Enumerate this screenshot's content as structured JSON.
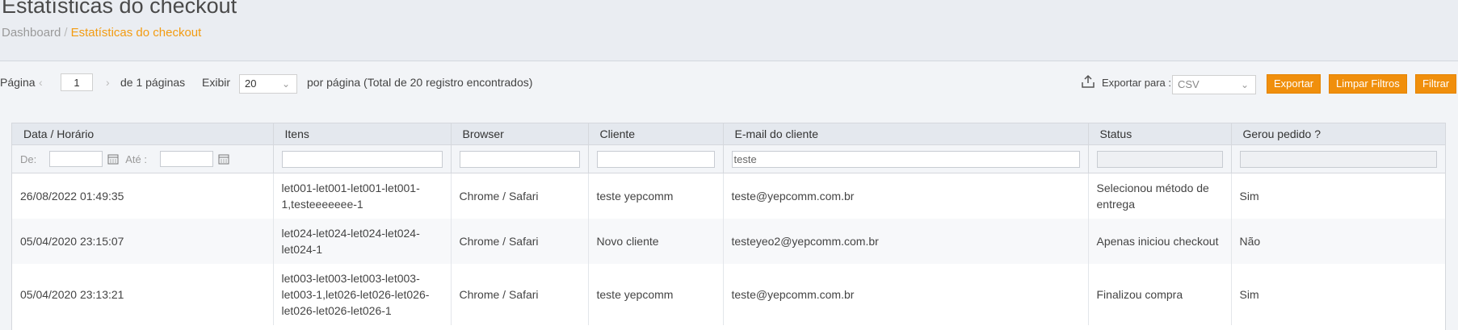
{
  "page": {
    "title": "Estatísticas do checkout",
    "breadcrumb": {
      "home": "Dashboard",
      "separator": "/",
      "current": "Estatísticas do checkout"
    }
  },
  "pagination": {
    "page_label": "Página",
    "prev_arrow": "‹",
    "current_page": "1",
    "next_arrow": "›",
    "of_pages": "de 1 páginas",
    "show_label": "Exibir",
    "per_page": "20",
    "per_page_suffix": "por página (Total de 20 registro encontrados)"
  },
  "export": {
    "label": "Exportar para :",
    "format": "CSV",
    "export_button": "Exportar",
    "clear_button": "Limpar Filtros",
    "filter_button": "Filtrar"
  },
  "table": {
    "columns": [
      "Data / Horário",
      "Itens",
      "Browser",
      "Cliente",
      "E-mail do cliente",
      "Status",
      "Gerou pedido ?"
    ],
    "filters": {
      "date_from_label": "De:",
      "date_to_label": "Até :",
      "email_value": "teste"
    },
    "rows": [
      {
        "datetime": "26/08/2022 01:49:35",
        "items": "let001-let001-let001-let001-1,testeeeeeee-1",
        "browser": "Chrome / Safari",
        "client": "teste yepcomm",
        "email": "teste@yepcomm.com.br",
        "status": "Selecionou método de entrega",
        "order": "Sim"
      },
      {
        "datetime": "05/04/2020 23:15:07",
        "items": "let024-let024-let024-let024-let024-1",
        "browser": "Chrome / Safari",
        "client": "Novo cliente",
        "email": "testeyeo2@yepcomm.com.br",
        "status": "Apenas iniciou checkout",
        "order": "Não"
      },
      {
        "datetime": "05/04/2020 23:13:21",
        "items": "let003-let003-let003-let003-let003-1,let026-let026-let026-let026-let026-let026-1",
        "browser": "Chrome / Safari",
        "client": "teste yepcomm",
        "email": "teste@yepcomm.com.br",
        "status": "Finalizou compra",
        "order": "Sim"
      }
    ]
  },
  "colors": {
    "accent": "#f08f0c",
    "breadcrumb_current": "#f39c12"
  },
  "icons": {
    "upload": "upload-icon",
    "calendar": "calendar-icon",
    "chevron": "chevron-down-icon"
  }
}
